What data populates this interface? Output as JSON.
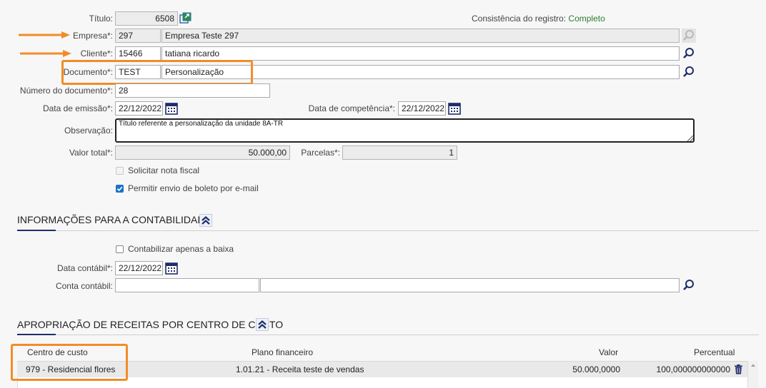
{
  "header": {
    "titulo_label": "Título:",
    "titulo_value": "6508",
    "consistencia_label": "Consistência do registro:",
    "consistencia_value": "Completo"
  },
  "form": {
    "empresa_label": "Empresa*:",
    "empresa_code": "297",
    "empresa_name": "Empresa Teste 297",
    "cliente_label": "Cliente*:",
    "cliente_code": "15466",
    "cliente_name": "tatiana  ricardo",
    "documento_label": "Documento*:",
    "documento_code": "TEST",
    "documento_name": "Personalização",
    "numero_label": "Número do documento*:",
    "numero_value": "28",
    "emissao_label": "Data de emissão*:",
    "emissao_value": "22/12/2022",
    "competencia_label": "Data de competência*:",
    "competencia_value": "22/12/2022",
    "observacao_label": "Observação:",
    "observacao_value": "Título referente a personalização da unidade 8A-TR",
    "valor_label": "Valor total*:",
    "valor_value": "50.000,00",
    "parcelas_label": "Parcelas*:",
    "parcelas_value": "1",
    "solicitar_label": "Solicitar nota fiscal",
    "solicitar_checked": false,
    "permitir_label": "Permitir envio de boleto por e-mail",
    "permitir_checked": true
  },
  "contabilidade": {
    "title": "INFORMAÇÕES PARA A CONTABILIDADE",
    "contabilizar_label": "Contabilizar apenas a baixa",
    "contabilizar_checked": false,
    "data_label": "Data contábil*:",
    "data_value": "22/12/2022",
    "conta_label": "Conta contábil:",
    "conta_code": "",
    "conta_name": ""
  },
  "apropriacao": {
    "title": "APROPRIAÇÃO DE RECEITAS POR CENTRO DE CUSTO",
    "columns": [
      "Centro de custo",
      "Plano financeiro",
      "Valor",
      "Percentual"
    ],
    "rows": [
      {
        "centro": "979 - Residencial flores",
        "plano": "1.01.21 - Receita teste de vendas",
        "valor": "50.000,0000",
        "percentual": "100,000000000000"
      }
    ]
  },
  "colors": {
    "accent_orange": "#f28c28",
    "link_green": "#2e7d32",
    "nav_blue": "#1f2d6b",
    "check_blue": "#1a73c8"
  }
}
